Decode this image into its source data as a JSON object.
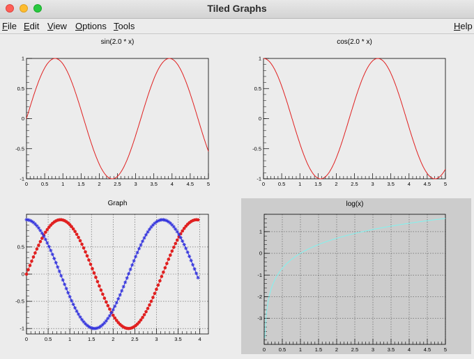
{
  "window": {
    "title": "Tiled Graphs"
  },
  "menu": [
    {
      "name": "menu-file",
      "label": "File",
      "underline": "F"
    },
    {
      "name": "menu-edit",
      "label": "Edit",
      "underline": "E"
    },
    {
      "name": "menu-view",
      "label": "View",
      "underline": "V"
    },
    {
      "name": "menu-options",
      "label": "Options",
      "underline": "O"
    },
    {
      "name": "menu-tools",
      "label": "Tools",
      "underline": "T"
    },
    {
      "name": "menu-help",
      "label": "Help",
      "underline": "H"
    }
  ],
  "colors": {
    "red": "#e02020",
    "blue": "#3333dd",
    "cyan": "#7ff3f0",
    "pad_gray": "#cccccc"
  },
  "chart_data": [
    {
      "type": "line",
      "title": "sin(2.0 * x)",
      "xlim": [
        0,
        5
      ],
      "ylim": [
        -1,
        1
      ],
      "xticks": [
        "0",
        "0.5",
        "1",
        "1.5",
        "2",
        "2.5",
        "3",
        "3.5",
        "4",
        "4.5",
        "5"
      ],
      "yticks": [
        "1",
        "0.5",
        "0",
        "-0.5",
        "-1"
      ],
      "function": "sin(2.0 * x)",
      "color": "red",
      "grid": false
    },
    {
      "type": "line",
      "title": "cos(2.0 * x)",
      "xlim": [
        0,
        5
      ],
      "ylim": [
        -1,
        1
      ],
      "xticks": [
        "0",
        "0.5",
        "1",
        "1.5",
        "2",
        "2.5",
        "3",
        "3.5",
        "4",
        "4.5",
        "5"
      ],
      "yticks": [
        "1",
        "0.5",
        "0",
        "-0.5",
        "-1"
      ],
      "function": "cos(2.0 * x)",
      "color": "red",
      "grid": false
    },
    {
      "type": "scatter",
      "title": "Graph",
      "xlim": [
        0,
        4.2
      ],
      "ylim": [
        -1.1,
        1.1
      ],
      "xticks": [
        "0",
        "0.5",
        "1",
        "1.5",
        "2",
        "2.5",
        "3",
        "3.5",
        "4"
      ],
      "yticks": [
        "0.5",
        "0",
        "-0.5",
        "-1"
      ],
      "grid": true,
      "series": [
        {
          "color": "red",
          "marker": "circle",
          "x_range": [
            0,
            3.96
          ],
          "x_step": 0.04,
          "function": "sin(2.0 * x)"
        },
        {
          "color": "blue",
          "marker": "star",
          "x_range": [
            0,
            3.96
          ],
          "x_step": 0.04,
          "function": "cos(2.0 * x)"
        }
      ]
    },
    {
      "type": "line",
      "title": "log(x)",
      "xlim": [
        0,
        5
      ],
      "ylim": [
        -4.2,
        1.8
      ],
      "xticks": [
        "0",
        "0.5",
        "1",
        "1.5",
        "2",
        "2.5",
        "3",
        "3.5",
        "4",
        "4.5",
        "5"
      ],
      "yticks": [
        "1",
        "0",
        "-1",
        "-2",
        "-3"
      ],
      "grid": true,
      "function": "log(x)",
      "color": "cyan",
      "background": "gray"
    }
  ]
}
